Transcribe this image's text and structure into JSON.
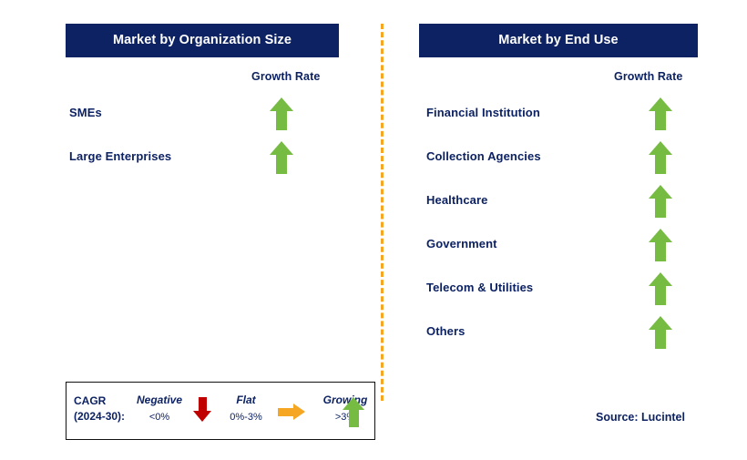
{
  "colors": {
    "header_bg": "#0d2263",
    "header_text": "#ffffff",
    "text_navy": "#0d2263",
    "growing_green": "#76bc43",
    "negative_red": "#c00000",
    "flat_orange": "#f5a623",
    "divider_orange": "#f5a623"
  },
  "panels": [
    {
      "title": "Market by Organization Size",
      "growth_label": "Growth Rate",
      "rows": [
        {
          "label": "SMEs",
          "growth": "growing",
          "arrow": "arrow-up-icon"
        },
        {
          "label": "Large Enterprises",
          "growth": "growing",
          "arrow": "arrow-up-icon"
        }
      ]
    },
    {
      "title": "Market by End Use",
      "growth_label": "Growth Rate",
      "rows": [
        {
          "label": "Financial Institution",
          "growth": "growing",
          "arrow": "arrow-up-icon"
        },
        {
          "label": "Collection Agencies",
          "growth": "growing",
          "arrow": "arrow-up-icon"
        },
        {
          "label": "Healthcare",
          "growth": "growing",
          "arrow": "arrow-up-icon"
        },
        {
          "label": "Government",
          "growth": "growing",
          "arrow": "arrow-up-icon"
        },
        {
          "label": "Telecom & Utilities",
          "growth": "growing",
          "arrow": "arrow-up-icon"
        },
        {
          "label": "Others",
          "growth": "growing",
          "arrow": "arrow-up-icon"
        }
      ]
    }
  ],
  "legend": {
    "cagr_line1": "CAGR",
    "cagr_line2": "(2024-30):",
    "items": [
      {
        "title": "Negative",
        "sub": "<0%",
        "icon": "arrow-down-icon"
      },
      {
        "title": "Flat",
        "sub": "0%-3%",
        "icon": "arrow-right-icon"
      },
      {
        "title": "Growing",
        "sub": ">3%",
        "icon": "arrow-up-icon"
      }
    ]
  },
  "source": "Source: Lucintel"
}
